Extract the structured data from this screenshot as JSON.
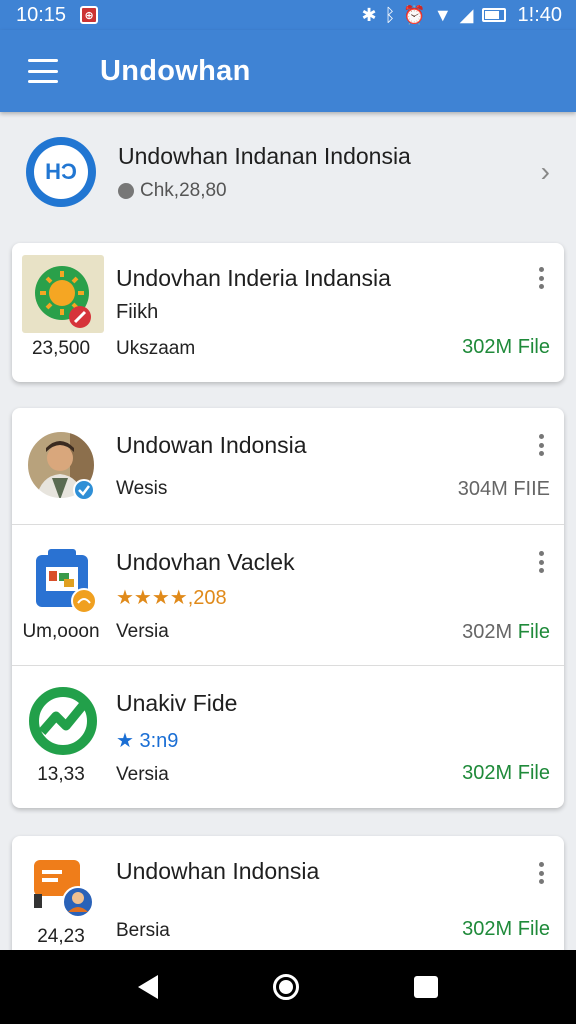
{
  "status_bar": {
    "time_left": "10:15",
    "notif_icon": "app-notification-icon",
    "time_right": "1!:40",
    "icons": [
      "bluetooth-icon",
      "vibrate-icon",
      "alarm-icon",
      "wifi-icon",
      "signal-icon",
      "battery-icon"
    ]
  },
  "app_bar": {
    "title": "Undowhan",
    "menu_icon": "hamburger-menu-icon"
  },
  "header": {
    "logo_text": "HƆ",
    "title": "Undowhan Indanan Indonsia",
    "subtitle": "Chk,28,80",
    "chevron": "›"
  },
  "cards": [
    {
      "rows": [
        {
          "title": "Undovhan Inderia Indansia",
          "line2": "Fiikh",
          "line3": "Ukszaam",
          "left_count": "23,500",
          "size_num": "302M",
          "size_unit": "File",
          "size_style": "green",
          "thumb": "sun-badge-icon"
        }
      ]
    },
    {
      "rows": [
        {
          "title": "Undowan Indonsia",
          "line2": "",
          "line3": "Wesis",
          "left_count": "",
          "size_num": "304M",
          "size_unit": "FIIE",
          "size_style": "grey",
          "thumb": "user-avatar-verified"
        },
        {
          "title": "Undovhan Vaclek",
          "line2_stars": "★★★★",
          "line2_rest": ",208",
          "line3": "Versia",
          "left_count": "Um,ooon",
          "size_num": "302M",
          "size_unit": "File",
          "size_style": "mixed",
          "thumb": "camera-gallery-icon"
        },
        {
          "title": "Unakiv Fide",
          "line2_stars": "★",
          "line2_rest": " 3:n9",
          "line3": "Versia",
          "left_count": "13,33",
          "size_num": "302M",
          "size_unit": "File",
          "size_style": "green",
          "thumb": "green-chart-circle-icon"
        }
      ]
    },
    {
      "rows": [
        {
          "title": "Undowhan Indonsia",
          "line2": "",
          "line3": "Bersia",
          "left_count": "24,23",
          "size_num": "302M",
          "size_unit": "File",
          "size_style": "green",
          "thumb": "orange-mailbox-icon"
        }
      ]
    }
  ],
  "nav_bar": {
    "back": "back-icon",
    "home": "home-icon",
    "recent": "recent-apps-icon"
  }
}
